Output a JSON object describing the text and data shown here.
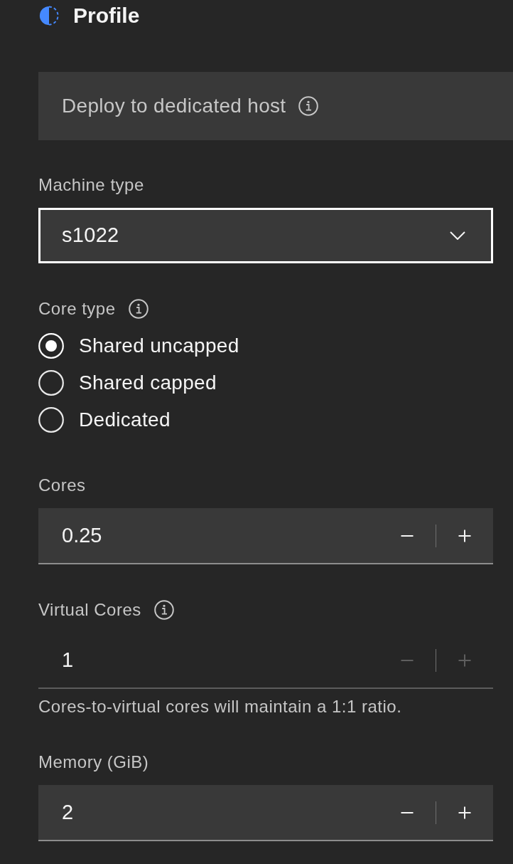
{
  "header": {
    "title": "Profile"
  },
  "dedicated_host": {
    "label": "Deploy to dedicated host",
    "info": true
  },
  "machine_type": {
    "label": "Machine type",
    "value": "s1022",
    "focused": true
  },
  "core_type": {
    "label": "Core type",
    "info": true,
    "options": [
      {
        "label": "Shared uncapped",
        "selected": true
      },
      {
        "label": "Shared capped",
        "selected": false
      },
      {
        "label": "Dedicated",
        "selected": false
      }
    ]
  },
  "number_fields": [
    {
      "label": "Cores",
      "info": false,
      "value": "0.25",
      "disabled": false
    },
    {
      "label": "Virtual Cores",
      "info": true,
      "value": "1",
      "disabled": true,
      "helper": "Cores-to-virtual cores will maintain a 1:1 ratio."
    },
    {
      "label": "Memory (GiB)",
      "info": false,
      "value": "2",
      "disabled": false
    }
  ]
}
